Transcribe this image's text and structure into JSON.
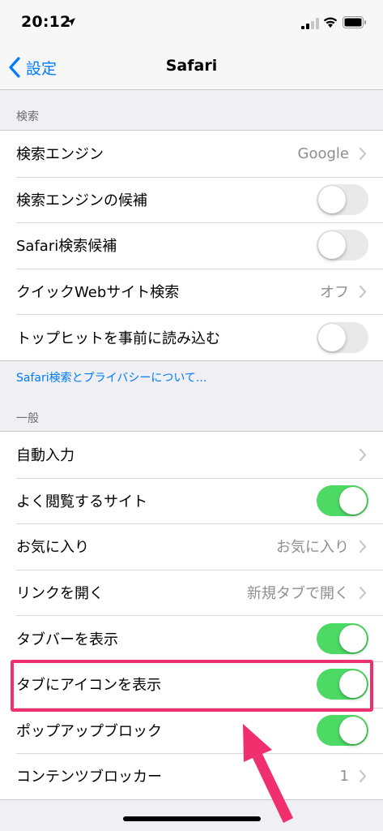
{
  "status_bar": {
    "time": "20:12",
    "icons": [
      "location-arrow-icon",
      "signal-icon",
      "wifi-icon",
      "battery-icon"
    ]
  },
  "nav": {
    "back_label": "設定",
    "title": "Safari"
  },
  "search_section": {
    "header": "検索",
    "footer": "Safari検索とプライバシーについて...",
    "rows": [
      {
        "label": "検索エンジン",
        "value": "Google",
        "type": "disclosure"
      },
      {
        "label": "検索エンジンの候補",
        "type": "toggle",
        "on": false
      },
      {
        "label": "Safari検索候補",
        "type": "toggle",
        "on": false
      },
      {
        "label": "クイックWebサイト検索",
        "value": "オフ",
        "type": "disclosure"
      },
      {
        "label": "トップヒットを事前に読み込む",
        "type": "toggle",
        "on": false
      }
    ]
  },
  "general_section": {
    "header": "一般",
    "rows": [
      {
        "label": "自動入力",
        "value": "",
        "type": "disclosure"
      },
      {
        "label": "よく閲覧するサイト",
        "type": "toggle",
        "on": true
      },
      {
        "label": "お気に入り",
        "value": "お気に入り",
        "type": "disclosure"
      },
      {
        "label": "リンクを開く",
        "value": "新規タブで開く",
        "type": "disclosure"
      },
      {
        "label": "タブバーを表示",
        "type": "toggle",
        "on": true
      },
      {
        "label": "タブにアイコンを表示",
        "type": "toggle",
        "on": true
      },
      {
        "label": "ポップアップブロック",
        "type": "toggle",
        "on": true
      },
      {
        "label": "コンテンツブロッカー",
        "value": "1",
        "type": "disclosure"
      }
    ]
  },
  "colors": {
    "accent": "#007aff",
    "toggle_on": "#4cd964",
    "highlight": "#f0306e"
  }
}
